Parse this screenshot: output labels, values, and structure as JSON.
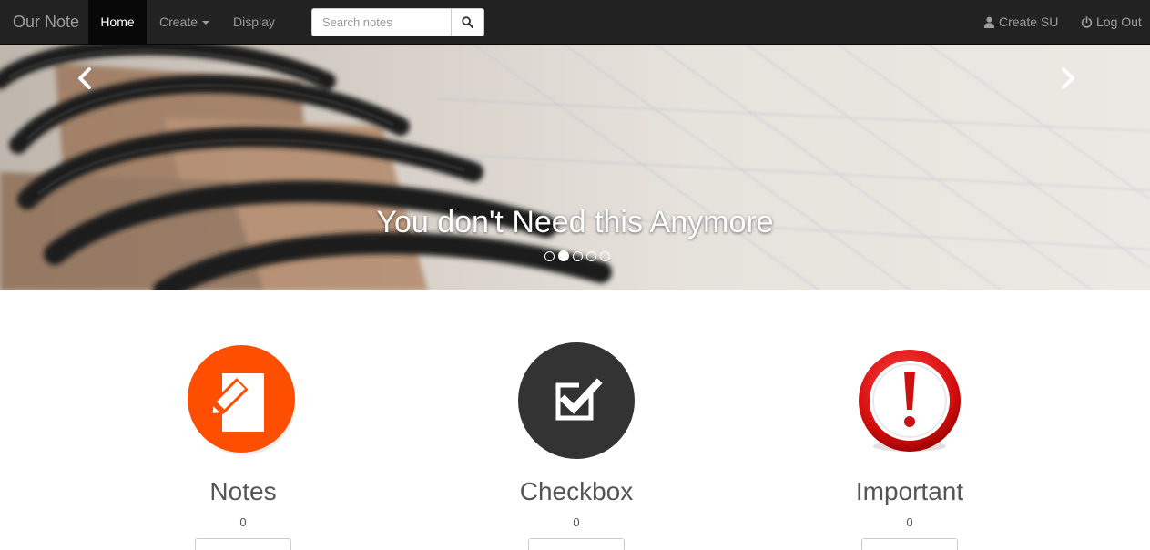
{
  "navbar": {
    "brand": "Our Note",
    "items": [
      {
        "label": "Home",
        "active": true
      },
      {
        "label": "Create",
        "dropdown": true
      },
      {
        "label": "Display"
      }
    ],
    "search": {
      "placeholder": "Search notes",
      "value": "",
      "button_icon": "search-icon"
    },
    "right": [
      {
        "label": "Create SU",
        "icon": "user-icon"
      },
      {
        "label": "Log Out",
        "icon": "power-icon"
      }
    ]
  },
  "carousel": {
    "caption": "You don't Need this Anymore",
    "slide_count": 5,
    "active_index": 1,
    "prev_icon": "chevron-left-icon",
    "next_icon": "chevron-right-icon"
  },
  "features": [
    {
      "title": "Notes",
      "count": "0",
      "icon": "edit-note-icon",
      "color": "#fe4f00"
    },
    {
      "title": "Checkbox",
      "count": "0",
      "icon": "checkbox-icon",
      "color": "#333333"
    },
    {
      "title": "Important",
      "count": "0",
      "icon": "exclamation-icon",
      "color": "#d60d0d"
    }
  ]
}
